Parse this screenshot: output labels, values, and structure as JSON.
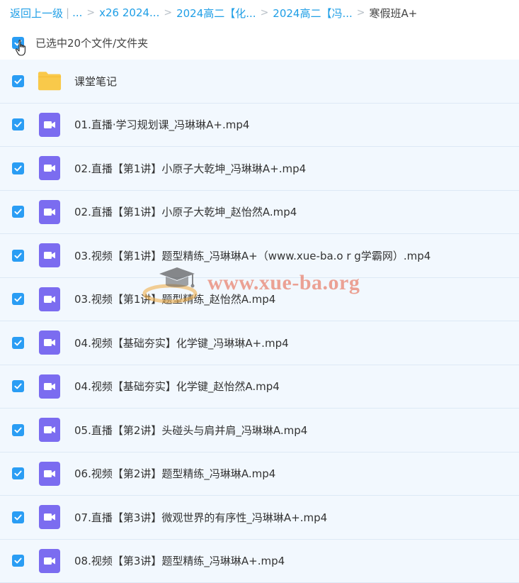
{
  "breadcrumb": {
    "back": "返回上一级",
    "ellipsis": "...",
    "items": [
      "x26 2024...",
      "2024高二【化...",
      "2024高二【冯..."
    ],
    "current": "寒假班A+"
  },
  "selection": {
    "text": "已选中20个文件/文件夹",
    "checked": true
  },
  "files": [
    {
      "name": "课堂笔记",
      "type": "folder",
      "checked": true
    },
    {
      "name": "01.直播·学习规划课_冯琳琳A+.mp4",
      "type": "video",
      "checked": true
    },
    {
      "name": "02.直播【第1讲】小原子大乾坤_冯琳琳A+.mp4",
      "type": "video",
      "checked": true
    },
    {
      "name": "02.直播【第1讲】小原子大乾坤_赵怡然A.mp4",
      "type": "video",
      "checked": true
    },
    {
      "name": "03.视频【第1讲】题型精练_冯琳琳A+（www.xue-ba.o r g学霸网）.mp4",
      "type": "video",
      "checked": true
    },
    {
      "name": "03.视频【第1讲】题型精练_赵怡然A.mp4",
      "type": "video",
      "checked": true
    },
    {
      "name": "04.视频【基础夯实】化学键_冯琳琳A+.mp4",
      "type": "video",
      "checked": true
    },
    {
      "name": "04.视频【基础夯实】化学键_赵怡然A.mp4",
      "type": "video",
      "checked": true
    },
    {
      "name": "05.直播【第2讲】头碰头与肩并肩_冯琳琳A.mp4",
      "type": "video",
      "checked": true
    },
    {
      "name": "06.视频【第2讲】题型精练_冯琳琳A.mp4",
      "type": "video",
      "checked": true
    },
    {
      "name": "07.直播【第3讲】微观世界的有序性_冯琳琳A+.mp4",
      "type": "video",
      "checked": true
    },
    {
      "name": "08.视频【第3讲】题型精练_冯琳琳A+.mp4",
      "type": "video",
      "checked": true
    }
  ],
  "watermark": {
    "text": "www.xue-ba.org"
  },
  "colors": {
    "accent": "#1e9ee6",
    "checkbox": "#2a9df4",
    "folder": "#f9c94a",
    "video_icon": "#7b6cf0",
    "row_bg": "#f2f8fe"
  }
}
